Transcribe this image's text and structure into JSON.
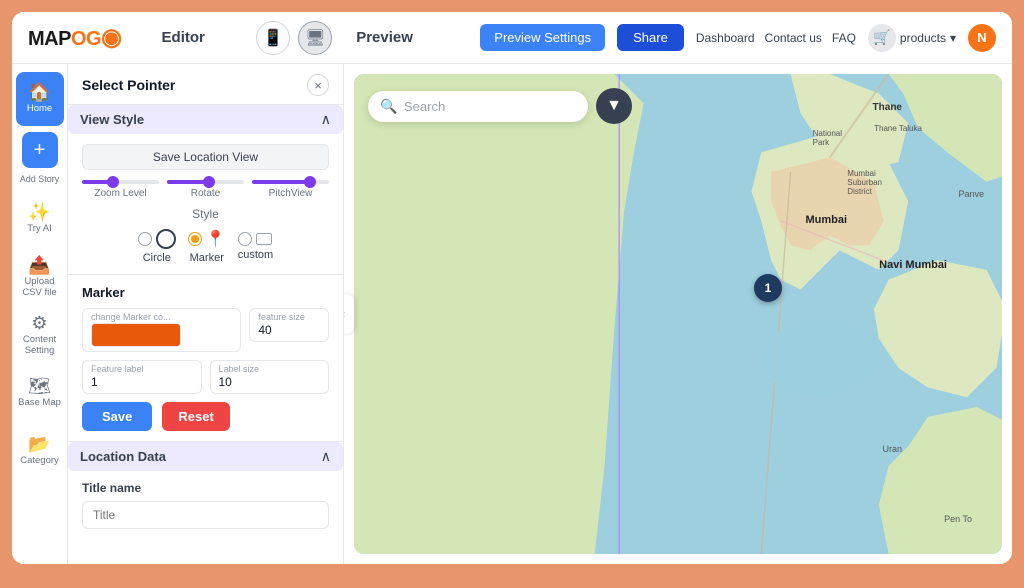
{
  "app": {
    "logo_map": "MAP",
    "logo_og": "OG",
    "editor_label": "Editor",
    "preview_label": "Preview"
  },
  "topnav": {
    "preview_settings_btn": "Preview Settings",
    "share_btn": "Share",
    "dashboard_link": "Dashboard",
    "contact_link": "Contact us",
    "faq_link": "FAQ",
    "products_label": "products",
    "user_initial": "N"
  },
  "sidebar": {
    "items": [
      {
        "id": "home",
        "label": "Home",
        "icon": "🏠",
        "active": true
      },
      {
        "id": "add-story",
        "label": "Add Story",
        "icon": "+",
        "is_add": true
      },
      {
        "id": "try-ai",
        "label": "Try AI",
        "icon": "✨"
      },
      {
        "id": "upload-csv",
        "label": "Upload CSV file",
        "icon": "📤"
      },
      {
        "id": "content-setting",
        "label": "Content Setting",
        "icon": "⚙"
      },
      {
        "id": "base-map",
        "label": "Base Map",
        "icon": "🗺"
      },
      {
        "id": "category",
        "label": "Category",
        "icon": "📂"
      }
    ]
  },
  "panel": {
    "title": "Select Pointer",
    "close_btn": "×",
    "view_style_section": {
      "title": "View Style",
      "save_location_btn": "Save Location View",
      "sliders": [
        {
          "label": "Zoom Level",
          "fill_pct": 40
        },
        {
          "label": "Rotate",
          "fill_pct": 55
        },
        {
          "label": "PitchView",
          "fill_pct": 75
        }
      ],
      "style_title": "Style",
      "radio_options": [
        {
          "id": "circle",
          "label": "Circle",
          "checked": false,
          "type": "circle"
        },
        {
          "id": "marker",
          "label": "Marker",
          "checked": true,
          "type": "marker"
        },
        {
          "id": "custom",
          "label": "custom",
          "checked": false,
          "type": "custom"
        }
      ]
    },
    "marker_section": {
      "title": "Marker",
      "change_marker_label": "change Marker co...",
      "feature_size_label": "feature size",
      "feature_size_value": "40",
      "feature_label_label": "Feature label",
      "feature_label_value": "1",
      "label_size_label": "Label size",
      "label_size_value": "10",
      "save_btn": "Save",
      "reset_btn": "Reset"
    },
    "location_data_section": {
      "title": "Location Data",
      "title_name_label": "Title name",
      "title_placeholder": "Title"
    }
  },
  "map": {
    "search_placeholder": "Search",
    "filter_icon": "▼",
    "marker_number": "1",
    "collapse_arrow": "‹"
  }
}
